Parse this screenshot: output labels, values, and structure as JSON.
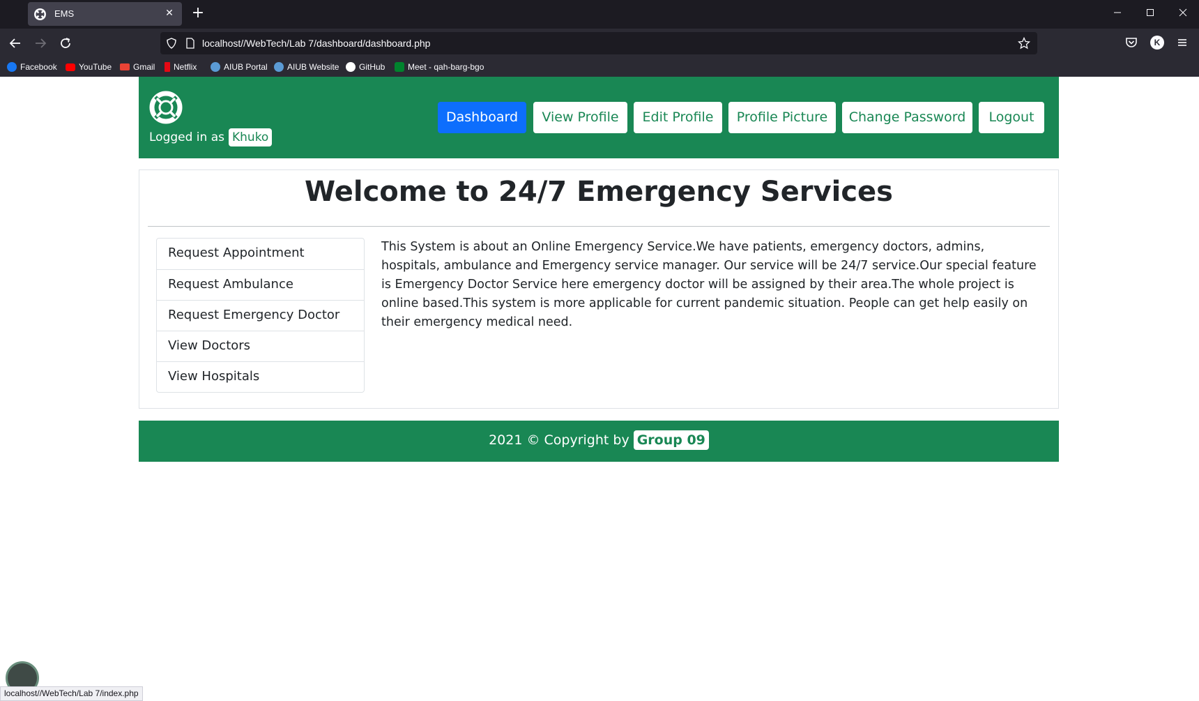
{
  "browser": {
    "tab_title": "EMS",
    "url": "localhost//WebTech/Lab 7/dashboard/dashboard.php",
    "status_url": "localhost//WebTech/Lab 7/index.php",
    "bookmarks": [
      {
        "label": "Facebook",
        "icon": "facebook-icon",
        "color": "#1877f2"
      },
      {
        "label": "YouTube",
        "icon": "youtube-icon",
        "color": "#ff0000"
      },
      {
        "label": "Gmail",
        "icon": "gmail-icon",
        "color": "#ea4335"
      },
      {
        "label": "Netflix",
        "icon": "netflix-icon",
        "color": "#e50914"
      },
      {
        "label": "AIUB Portal",
        "icon": "aiub-icon",
        "color": "#5b9bd5"
      },
      {
        "label": "AIUB Website",
        "icon": "aiub-icon",
        "color": "#5b9bd5"
      },
      {
        "label": "GitHub",
        "icon": "github-icon",
        "color": "#ffffff"
      },
      {
        "label": "Meet - qah-barg-bgo",
        "icon": "meet-icon",
        "color": "#00832d"
      }
    ],
    "profile_initial": "K"
  },
  "header": {
    "logo_icon": "lifebuoy-icon",
    "logged_in_prefix": "Logged in as",
    "username": "Khuko",
    "nav": [
      {
        "label": "Dashboard",
        "active": true
      },
      {
        "label": "View Profile",
        "active": false
      },
      {
        "label": "Edit Profile",
        "active": false
      },
      {
        "label": "Profile Picture",
        "active": false
      },
      {
        "label": "Change Password",
        "active": false
      },
      {
        "label": "Logout",
        "active": false
      }
    ]
  },
  "main": {
    "welcome_prefix": "Welcome to",
    "welcome_bold": "24/7 Emergency Services",
    "menu": [
      "Request Appointment",
      "Request Ambulance",
      "Request Emergency Doctor",
      "View Doctors",
      "View Hospitals"
    ],
    "about": "This System is about an Online Emergency Service.We have patients, emergency doctors, admins, hospitals, ambulance and Emergency service manager. Our service will be 24/7 service.Our special feature is Emergency Doctor Service here emergency doctor will be assigned by their area.The whole project is online based.This system is more applicable for current pandemic situation. People can get help easily on their emergency medical need."
  },
  "footer": {
    "text": "2021 © Copyright by",
    "group": "Group 09"
  },
  "colors": {
    "primary_green": "#198754",
    "active_blue": "#0d6efd"
  }
}
